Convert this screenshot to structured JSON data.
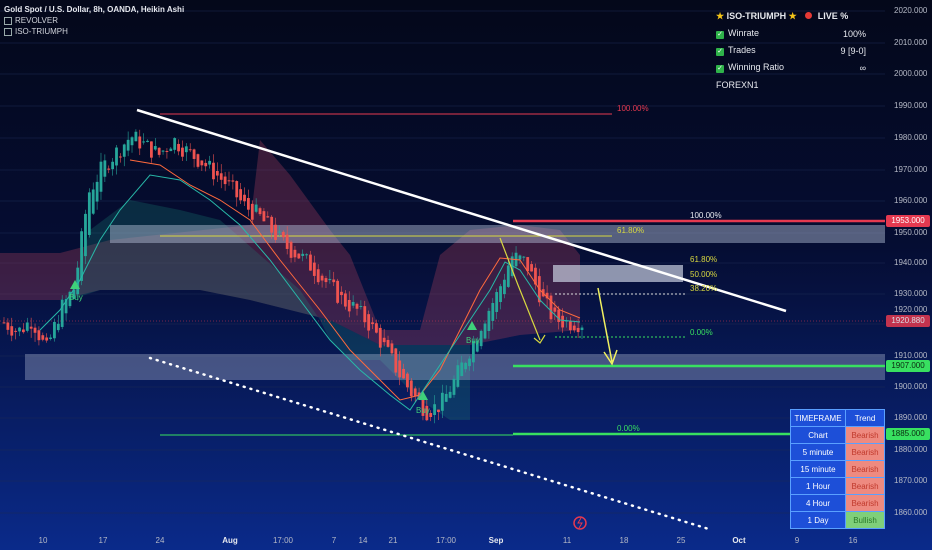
{
  "header": {
    "symbol": "Gold Spot / U.S. Dollar, 8h, OANDA, Heikin Ashi",
    "indicator1": "REVOLVER",
    "indicator2": "ISO-TRIUMPH"
  },
  "stats_panel": {
    "title": "ISO-TRIUMPH",
    "live": "LIVE %",
    "rows": [
      {
        "label": "Winrate",
        "value": "100%"
      },
      {
        "label": "Trades",
        "value": "9 [9-0]"
      },
      {
        "label": "Winning Ratio",
        "value": "∞"
      }
    ],
    "author": "FOREXN1"
  },
  "trend_table": {
    "headers": [
      "TIMEFRAME",
      "Trend"
    ],
    "rows": [
      {
        "tf": "Chart",
        "trend": "Bearish"
      },
      {
        "tf": "5 minute",
        "trend": "Bearish"
      },
      {
        "tf": "15 minute",
        "trend": "Bearish"
      },
      {
        "tf": "1 Hour",
        "trend": "Bearish"
      },
      {
        "tf": "4 Hour",
        "trend": "Bearish"
      },
      {
        "tf": "1 Day",
        "trend": "Bullish"
      }
    ]
  },
  "price_axis": [
    "2020.000",
    "2010.000",
    "2000.000",
    "1990.000",
    "1980.000",
    "1970.000",
    "1960.000",
    "1950.000",
    "1940.000",
    "1930.000",
    "1920.000",
    "1910.000",
    "1900.000",
    "1890.000",
    "1880.000",
    "1870.000",
    "1860.000"
  ],
  "price_tags": {
    "level_red": "1953.000",
    "current": "1920.880",
    "level_green_1": "1907.000",
    "level_green_2": "1885.000"
  },
  "time_axis": [
    "10",
    "17",
    "24",
    "Aug",
    "17:00",
    "7",
    "14",
    "21",
    "17:00",
    "Sep",
    "11",
    "18",
    "25",
    "Oct",
    "9",
    "16"
  ],
  "fib_labels": {
    "top_100": "100.00%",
    "r_100": "100.00%",
    "r_618": "61.80%",
    "s_618": "61.80%",
    "s_50": "50.00%",
    "s_382": "38.20%",
    "s_0": "0.00%",
    "bottom_0": "0.00%"
  },
  "signals": [
    "Buy",
    "Buy",
    "Buy"
  ],
  "colors": {
    "bull": "#26a69a",
    "bear": "#ef5350",
    "resistance": "#e53950",
    "support": "#38e060",
    "fib_yellow": "#d8d840"
  },
  "chart_data": {
    "type": "candlestick",
    "ylim": [
      1855,
      2023
    ],
    "candle_trend": [
      1921,
      1918,
      1922,
      1912,
      1925,
      1932,
      1962,
      1970,
      1975,
      1980,
      1977,
      1974,
      1979,
      1975,
      1972,
      1968,
      1964,
      1958,
      1955,
      1950,
      1945,
      1942,
      1938,
      1933,
      1928,
      1925,
      1920,
      1913,
      1905,
      1898,
      1893,
      1895,
      1903,
      1912,
      1922,
      1930,
      1942,
      1940,
      1930,
      1922,
      1921,
      1920.88
    ],
    "current_price": 1920.88,
    "levels": {
      "resistance": 1953,
      "support_1": 1907,
      "support_2": 1885
    }
  }
}
